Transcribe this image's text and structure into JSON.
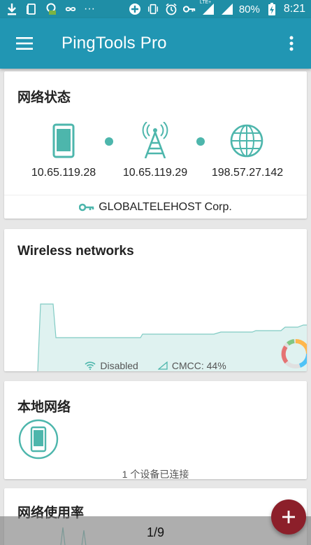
{
  "status_bar": {
    "battery": "80%",
    "time": "8:21",
    "network_type": "LTE+",
    "dots": "···"
  },
  "app_bar": {
    "title": "PingTools Pro"
  },
  "network_status": {
    "title": "网络状态",
    "nodes": [
      {
        "label": "10.65.119.28",
        "icon": "phone-icon"
      },
      {
        "label": "10.65.119.29",
        "icon": "cell-tower-icon"
      },
      {
        "label": "198.57.27.142",
        "icon": "globe-icon"
      }
    ],
    "isp": "GLOBALTELEHOST Corp."
  },
  "wireless": {
    "title": "Wireless networks",
    "wifi_status": "Disabled",
    "cell_status": "CMCC: 44%",
    "chart_data": {
      "type": "area",
      "color": "#4db6ac",
      "fill": "#dff2f0"
    }
  },
  "local_network": {
    "title": "本地网络",
    "devices": "1 个设备已连接"
  },
  "usage": {
    "title": "网络使用率"
  },
  "pager": "1/9",
  "colors": {
    "primary": "#2196b3",
    "status": "#1f8ea6",
    "accent": "#4db6ac",
    "fab": "#8c1f2a"
  }
}
